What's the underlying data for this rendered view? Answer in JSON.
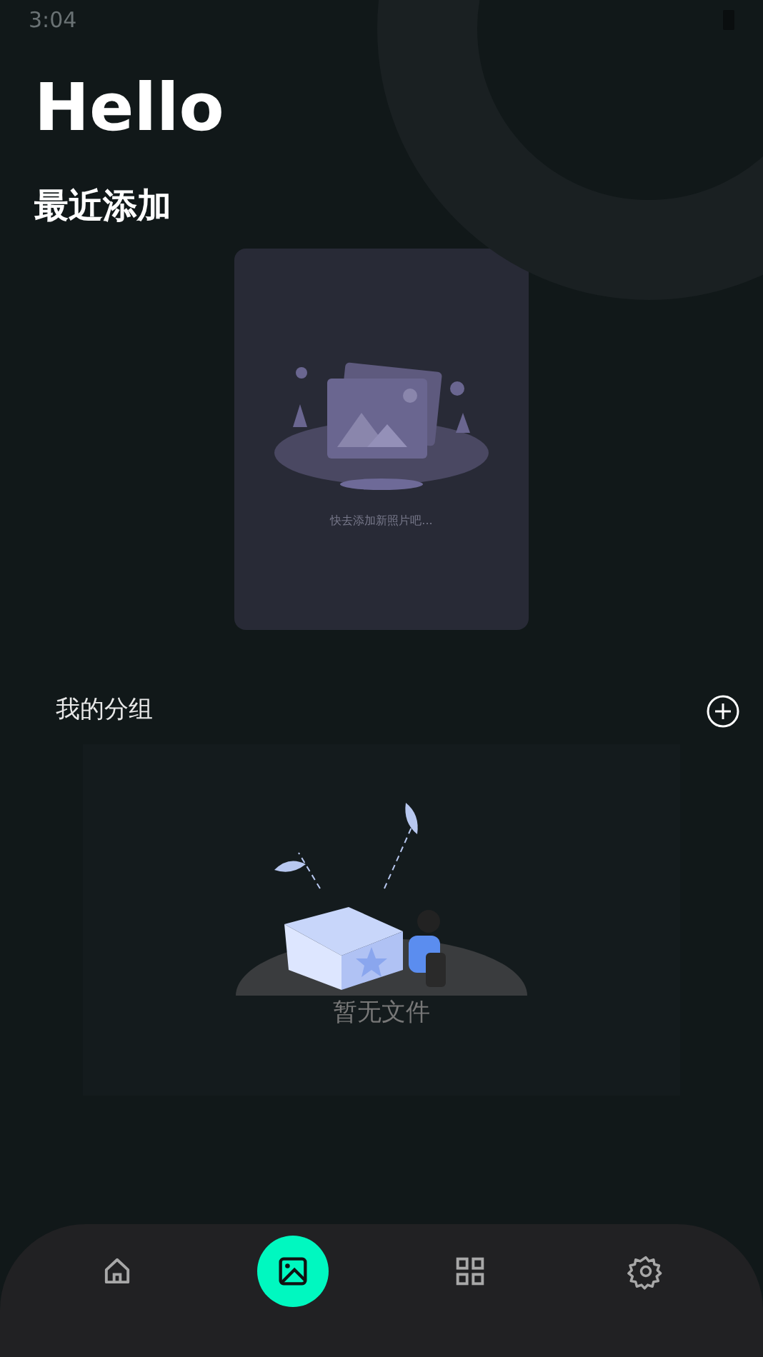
{
  "status_bar": {
    "time": "3:04"
  },
  "greeting": "Hello",
  "recent": {
    "title": "最近添加",
    "empty_text": "快去添加新照片吧..."
  },
  "groups": {
    "title": "我的分组",
    "empty_text": "暂无文件"
  },
  "nav": [
    {
      "kind": "home",
      "selected": false
    },
    {
      "kind": "gallery",
      "selected": true
    },
    {
      "kind": "grid",
      "selected": false
    },
    {
      "kind": "settings",
      "selected": false
    }
  ]
}
